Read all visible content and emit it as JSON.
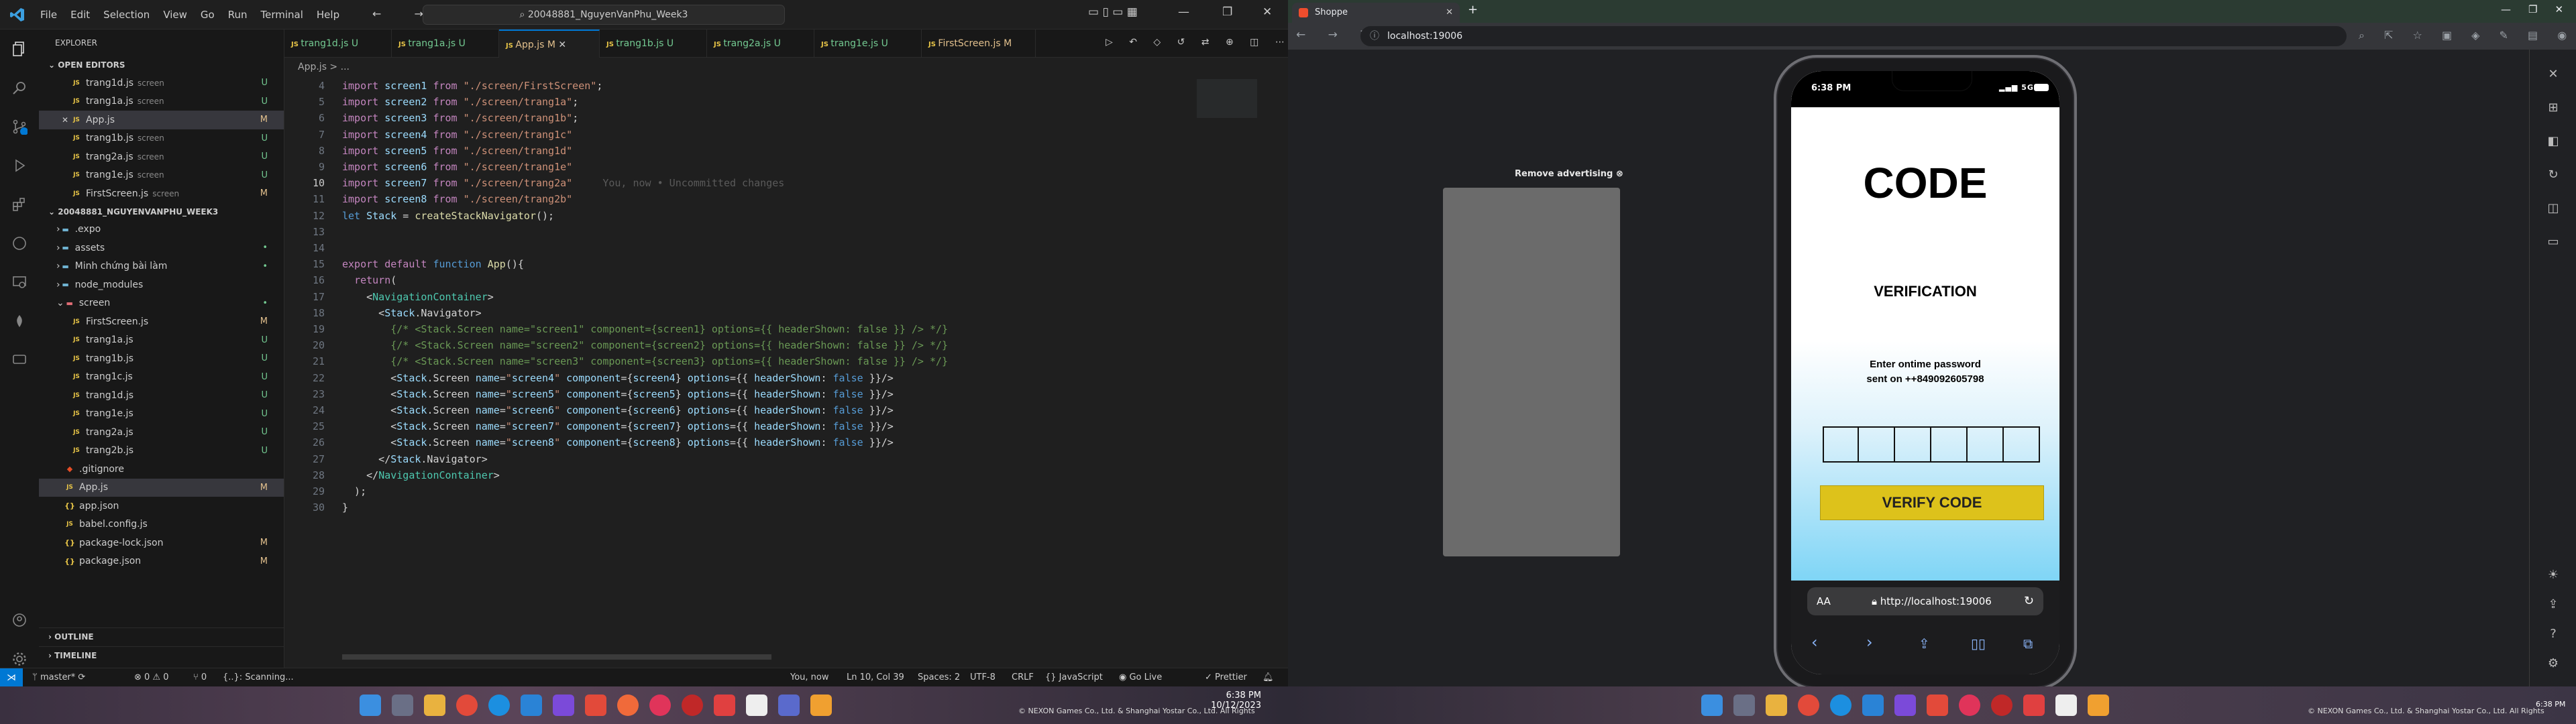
{
  "vscode": {
    "menu": [
      "File",
      "Edit",
      "Selection",
      "View",
      "Go",
      "Run",
      "Terminal",
      "Help"
    ],
    "search": "20048881_NguyenVanPhu_Week3",
    "tabs": [
      {
        "label": "trang1d.js",
        "status": "U"
      },
      {
        "label": "trang1a.js",
        "status": "U"
      },
      {
        "label": "App.js",
        "status": "M"
      },
      {
        "label": "trang1b.js",
        "status": "U"
      },
      {
        "label": "trang2a.js",
        "status": "U"
      },
      {
        "label": "trang1e.js",
        "status": "U"
      },
      {
        "label": "FirstScreen.js",
        "status": "M"
      }
    ],
    "breadcrumb": "App.js > ...",
    "explorer_title": "EXPLORER",
    "open_editors_title": "OPEN EDITORS",
    "open_editors": [
      {
        "name": "trang1d.js",
        "desc": "screen",
        "status": "U"
      },
      {
        "name": "trang1a.js",
        "desc": "screen",
        "status": "U"
      },
      {
        "name": "App.js",
        "desc": "",
        "status": "M"
      },
      {
        "name": "trang1b.js",
        "desc": "screen",
        "status": "U"
      },
      {
        "name": "trang2a.js",
        "desc": "screen",
        "status": "U"
      },
      {
        "name": "trang1e.js",
        "desc": "screen",
        "status": "U"
      },
      {
        "name": "FirstScreen.js",
        "desc": "screen",
        "status": "M"
      }
    ],
    "project_title": "20048881_NGUYENVANPHU_WEEK3",
    "tree": [
      {
        "name": ".expo",
        "type": "folder",
        "depth": 1,
        "status": ""
      },
      {
        "name": "assets",
        "type": "folder",
        "depth": 1,
        "status": "•"
      },
      {
        "name": "Minh chứng bài làm",
        "type": "folder",
        "depth": 1,
        "status": "•"
      },
      {
        "name": "node_modules",
        "type": "folder",
        "depth": 1,
        "status": ""
      },
      {
        "name": "screen",
        "type": "folder-open",
        "depth": 1,
        "status": "•"
      },
      {
        "name": "FirstScreen.js",
        "type": "js",
        "depth": 2,
        "status": "M"
      },
      {
        "name": "trang1a.js",
        "type": "js",
        "depth": 2,
        "status": "U"
      },
      {
        "name": "trang1b.js",
        "type": "js",
        "depth": 2,
        "status": "U"
      },
      {
        "name": "trang1c.js",
        "type": "js",
        "depth": 2,
        "status": "U"
      },
      {
        "name": "trang1d.js",
        "type": "js",
        "depth": 2,
        "status": "U"
      },
      {
        "name": "trang1e.js",
        "type": "js",
        "depth": 2,
        "status": "U"
      },
      {
        "name": "trang2a.js",
        "type": "js",
        "depth": 2,
        "status": "U"
      },
      {
        "name": "trang2b.js",
        "type": "js",
        "depth": 2,
        "status": "U"
      },
      {
        "name": ".gitignore",
        "type": "git",
        "depth": 1,
        "status": ""
      },
      {
        "name": "App.js",
        "type": "js",
        "depth": 1,
        "status": "M"
      },
      {
        "name": "app.json",
        "type": "json",
        "depth": 1,
        "status": ""
      },
      {
        "name": "babel.config.js",
        "type": "js",
        "depth": 1,
        "status": ""
      },
      {
        "name": "package-lock.json",
        "type": "json",
        "depth": 1,
        "status": "M"
      },
      {
        "name": "package.json",
        "type": "json",
        "depth": 1,
        "status": "M"
      }
    ],
    "outline_title": "OUTLINE",
    "timeline_title": "TIMELINE",
    "line_numbers": [
      "4",
      "5",
      "6",
      "7",
      "8",
      "9",
      "10",
      "11",
      "12",
      "13",
      "14",
      "15",
      "16",
      "17",
      "18",
      "19",
      "20",
      "21",
      "22",
      "23",
      "24",
      "25",
      "26",
      "27",
      "28",
      "29",
      "30"
    ],
    "code_lines": [
      "import screen1 from \"./screen/FirstScreen\";",
      "import screen2 from \"./screen/trang1a\";",
      "import screen3 from \"./screen/trang1b\";",
      "import screen4 from \"./screen/trang1c\"",
      "import screen5 from \"./screen/trang1d\"",
      "import screen6 from \"./screen/trang1e\"",
      "import screen7 from \"./screen/trang2a\"",
      "import screen8 from \"./screen/trang2b\"",
      "let Stack = createStackNavigator();",
      "",
      "",
      "export default function App(){",
      "  return(",
      "    <NavigationContainer>",
      "      <Stack.Navigator>",
      "        {/* <Stack.Screen name=\"screen1\" component={screen1} options={{ headerShown: false }} /> */}",
      "        {/* <Stack.Screen name=\"screen2\" component={screen2} options={{ headerShown: false }} /> */}",
      "        {/* <Stack.Screen name=\"screen3\" component={screen3} options={{ headerShown: false }} /> */}",
      "        <Stack.Screen name=\"screen4\" component={screen4} options={{ headerShown: false }}/>",
      "        <Stack.Screen name=\"screen5\" component={screen5} options={{ headerShown: false }}/>",
      "        <Stack.Screen name=\"screen6\" component={screen6} options={{ headerShown: false }}/>",
      "        <Stack.Screen name=\"screen7\" component={screen7} options={{ headerShown: false }}/>",
      "        <Stack.Screen name=\"screen8\" component={screen8} options={{ headerShown: false }}/>",
      "      </Stack.Navigator>",
      "    </NavigationContainer>",
      "  );",
      "}"
    ],
    "blame": "You, now • Uncommitted changes",
    "status": {
      "branch": "master*",
      "problems": "⊗ 0 ⚠ 0",
      "ports": "⑂ 0",
      "scanning": "{..}: Scanning...",
      "blame": "You, now",
      "position": "Ln 10, Col 39",
      "spaces": "Spaces: 2",
      "encoding": "UTF-8",
      "eol": "CRLF",
      "language": "{} JavaScript",
      "golive": "Go Live",
      "prettier": "Prettier"
    }
  },
  "browser": {
    "tab_title": "Shoppe",
    "url": "localhost:19006",
    "remove_ad": "Remove advertising",
    "phone": {
      "time": "6:38 PM",
      "signal": "5G",
      "title": "CODE",
      "subtitle": "VERIFICATION",
      "instruction_line1": "Enter ontime password",
      "instruction_line2": "sent on ++849092605798",
      "otp_boxes": 6,
      "button": "VERIFY CODE",
      "safari_aa": "AA",
      "safari_url": "http://localhost:19006"
    }
  },
  "taskbar": {
    "left_time": "6:38 PM",
    "left_date": "10/12/2023",
    "right_time": "6:38 PM",
    "copyright": "© NEXON Games Co., Ltd. & Shanghai Yostar Co., Ltd. All Rights"
  },
  "colors": {
    "accent": "#0078d4",
    "verify_button": "#ddc21b",
    "gradient_bottom": "#7fd5f6"
  }
}
